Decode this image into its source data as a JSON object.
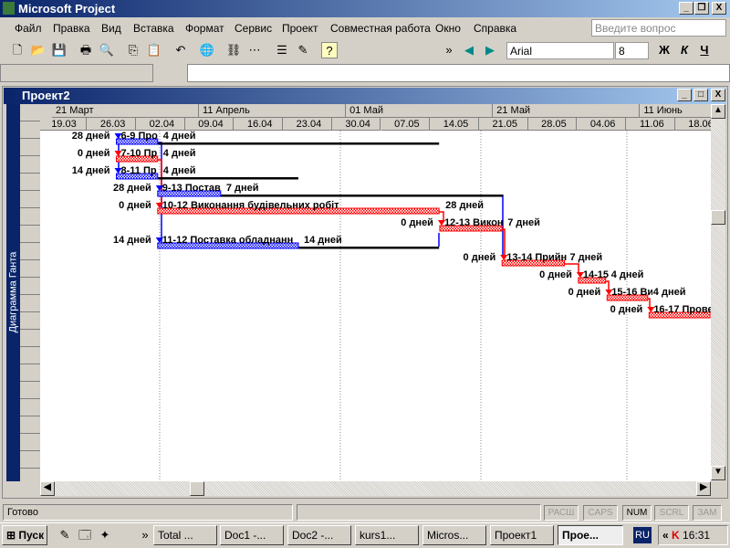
{
  "app": {
    "title": "Microsoft Project",
    "min": "_",
    "restore": "❐",
    "close": "X"
  },
  "menu": [
    "Файл",
    "Правка",
    "Вид",
    "Вставка",
    "Формат",
    "Сервис",
    "Проект",
    "Совместная работа",
    "Окно",
    "Справка"
  ],
  "ask_placeholder": "Введите вопрос",
  "toolbar": {
    "font": "Arial",
    "size": "8",
    "bold": "Ж",
    "italic": "К",
    "underline": "Ч"
  },
  "child": {
    "title": "Проект2",
    "min": "_",
    "max": "□",
    "close": "X"
  },
  "view_label": "Диаграмма Ганта",
  "timescale": {
    "months": [
      "21 Март",
      "11 Апрель",
      "01 Май",
      "21 Май",
      "11 Июнь"
    ],
    "weeks": [
      "19.03",
      "26.03",
      "02.04",
      "09.04",
      "16.04",
      "23.04",
      "30.04",
      "07.05",
      "14.05",
      "21.05",
      "28.05",
      "04.06",
      "11.06",
      "18.06"
    ]
  },
  "tasks": [
    {
      "slack": "28 дней",
      "name": "6-9 Про",
      "dur": "4 дней",
      "start": 11.2,
      "end": 17.1,
      "slack_end": 57.3,
      "critical": false
    },
    {
      "slack": "0 дней",
      "name": "7-10 Пр",
      "dur": "4 дней",
      "start": 11.2,
      "end": 17.1,
      "slack_end": null,
      "critical": true
    },
    {
      "slack": "14 дней",
      "name": "8-11 Пр",
      "dur": "4 дней",
      "start": 11.2,
      "end": 17.1,
      "slack_end": 37.2,
      "critical": false
    },
    {
      "slack": "28 дней",
      "name": "9-13 Постав",
      "dur": "7 дней",
      "start": 17.1,
      "end": 26.1,
      "slack_end": 66.4,
      "critical": false
    },
    {
      "slack": "0 дней",
      "name": "10-12 Виконання будівельних робіт",
      "dur": "28 дней",
      "start": 17.1,
      "end": 57.3,
      "slack_end": null,
      "critical": true
    },
    {
      "slack": "0 дней",
      "name": "12-13 Викон",
      "dur": "7 дней",
      "start": 57.4,
      "end": 66.3,
      "slack_end": null,
      "critical": true
    },
    {
      "slack": "14 дней",
      "name": "11-12 Поставка обладнанн",
      "dur": "14 дней",
      "start": 17.1,
      "end": 37.2,
      "slack_end": 57.3,
      "critical": false
    },
    {
      "slack": "0 дней",
      "name": "13-14 Прийн",
      "dur": "7 дней",
      "start": 66.3,
      "end": 75.2,
      "slack_end": null,
      "critical": true
    },
    {
      "slack": "0 дней",
      "name": "14-15",
      "dur": "4 дней",
      "start": 77.2,
      "end": 81.1,
      "slack_end": null,
      "critical": true
    },
    {
      "slack": "0 дней",
      "name": "15-16 Ви",
      "dur": "4 дней",
      "start": 81.3,
      "end": 87.1,
      "slack_end": null,
      "critical": true
    },
    {
      "slack": "0 дней",
      "name": "16-17 Прове",
      "dur": "",
      "start": 87.3,
      "end": 96,
      "slack_end": null,
      "critical": true
    }
  ],
  "colors": {
    "critical": "#ff0000",
    "normal": "#0000ff",
    "slack": "#000000"
  },
  "status": {
    "ready": "Готово",
    "indicators": [
      "РАСШ",
      "CAPS",
      "NUM",
      "SCRL",
      "ЗАМ"
    ],
    "active": "NUM"
  },
  "taskbar": {
    "start": "Пуск",
    "items": [
      "Total ...",
      "Doc1 -...",
      "Doc2 -...",
      "kurs1...",
      "Micros...",
      "Проект1",
      "Прое..."
    ],
    "lang": "RU",
    "time": "16:31"
  }
}
